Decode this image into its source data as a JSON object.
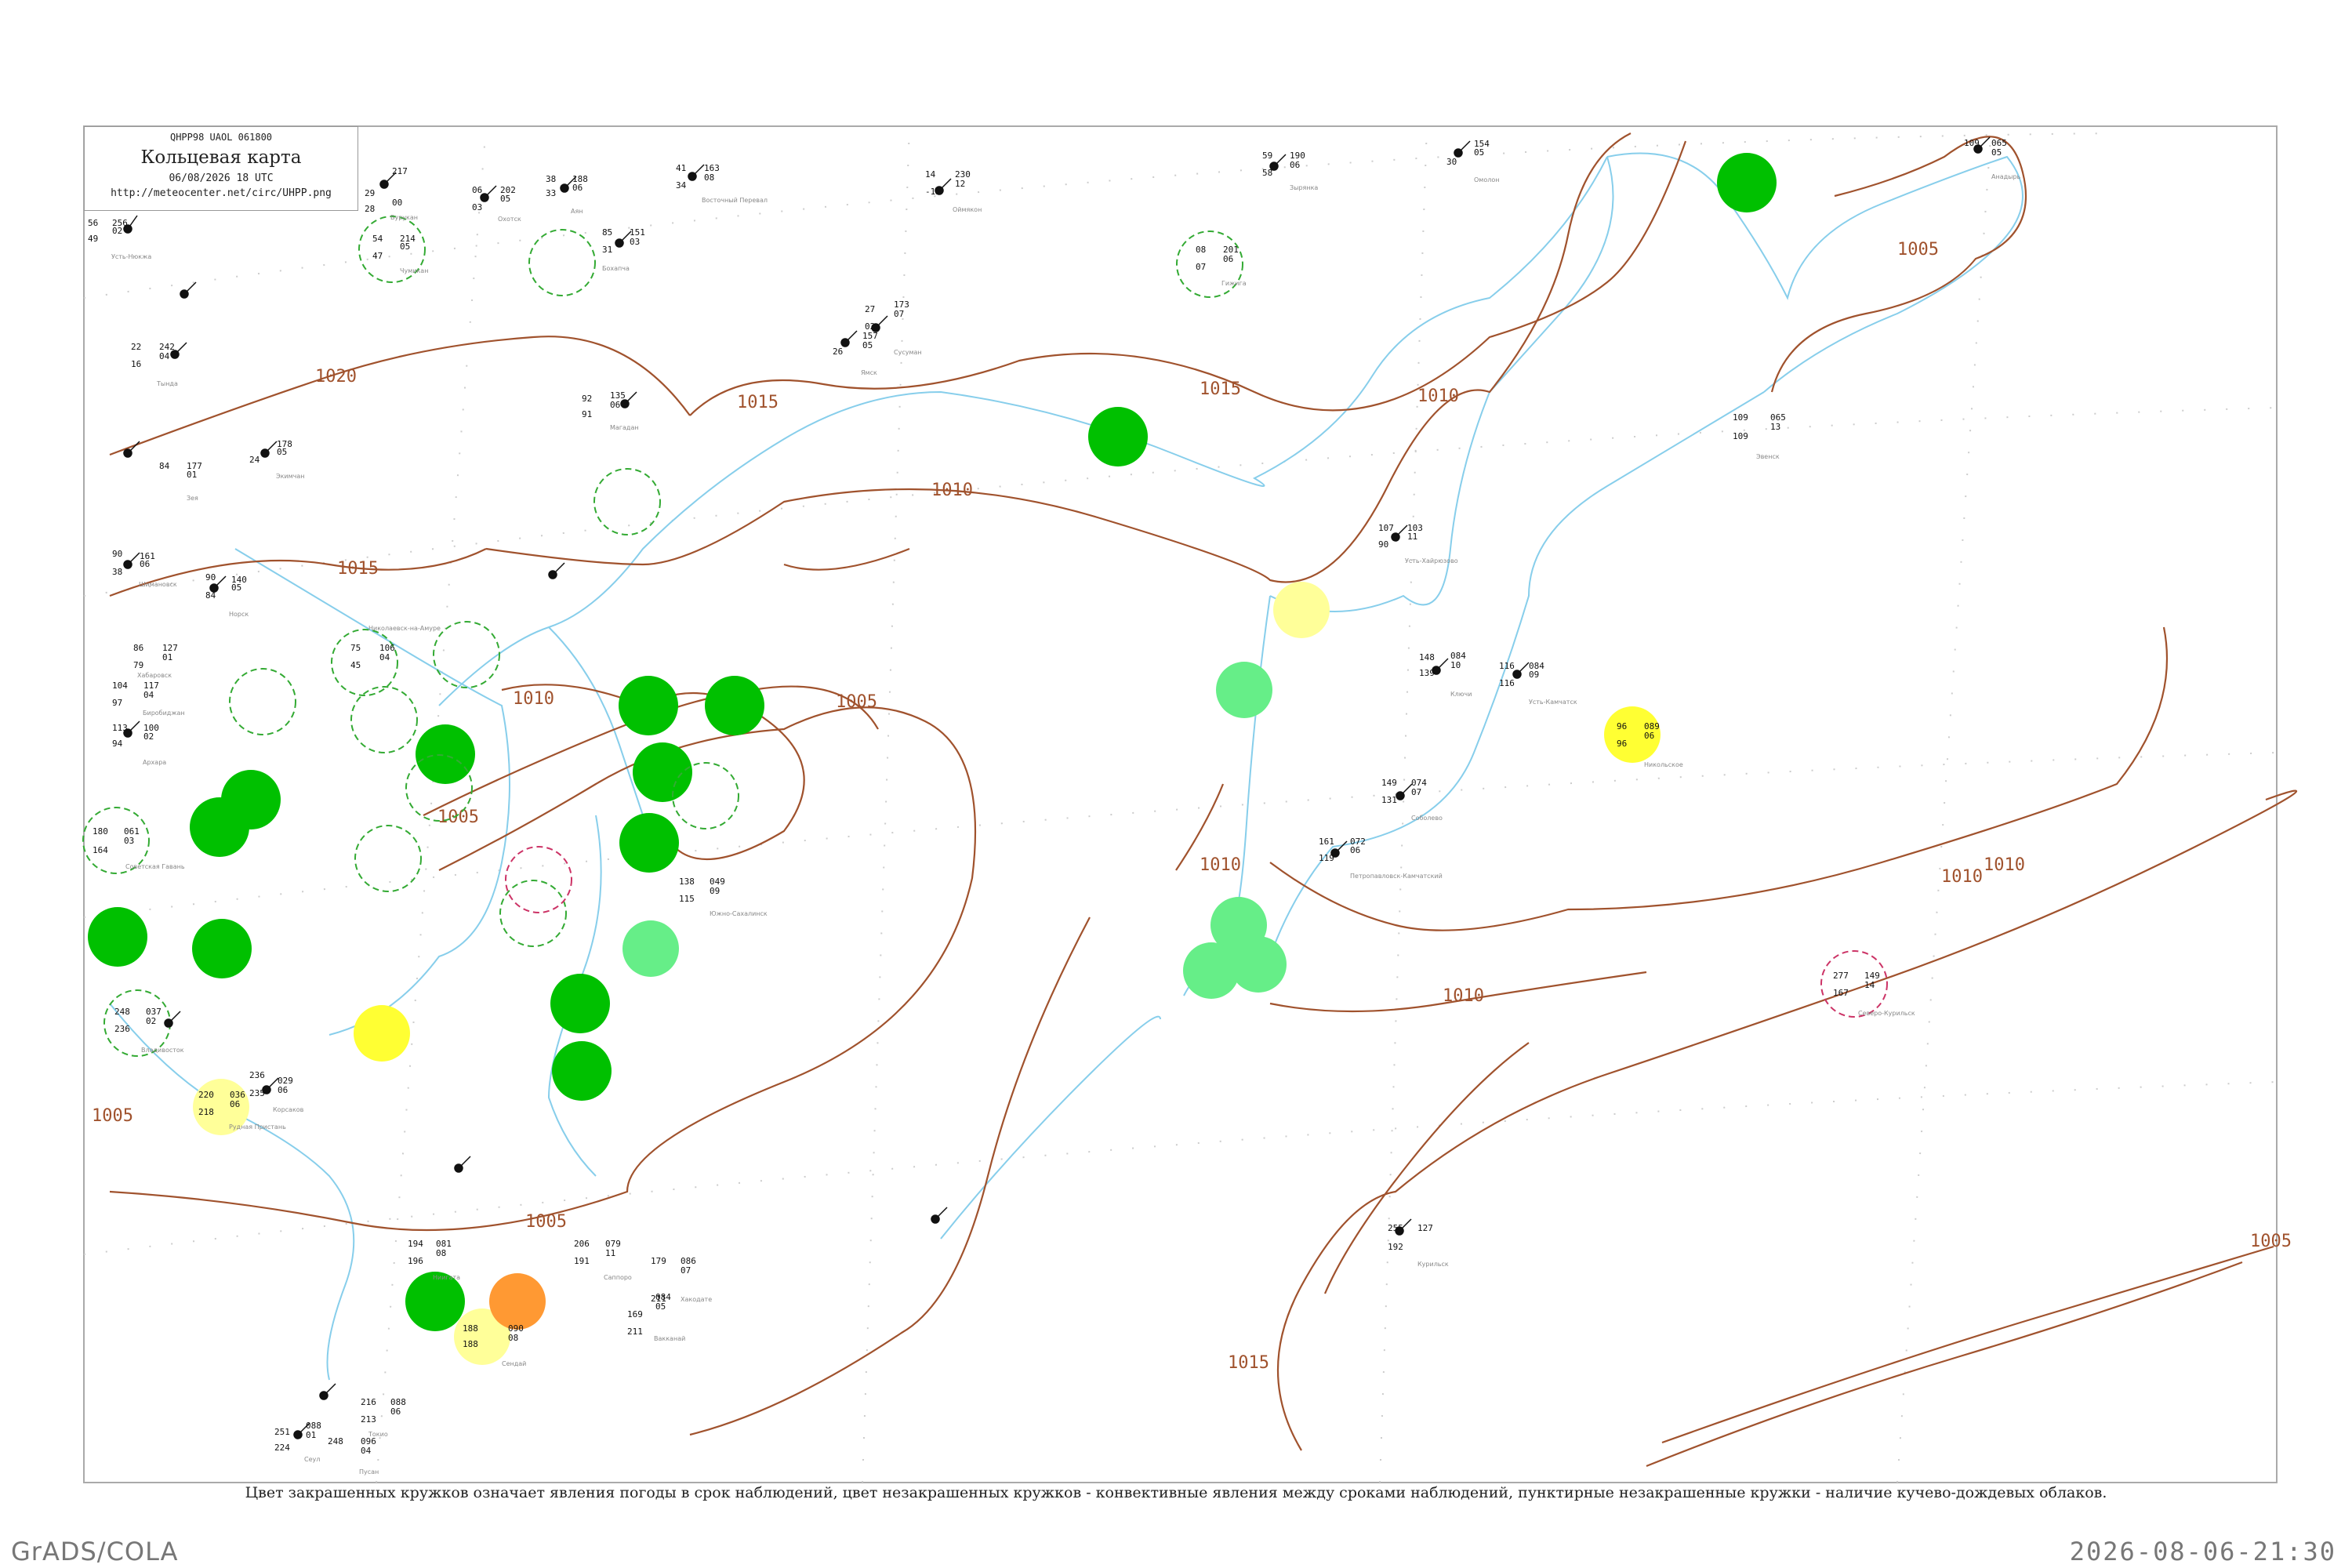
{
  "legend": {
    "code": "QHPP98  UAOL  061800",
    "title": "Кольцевая карта",
    "date": "06/08/2026 18 UTC",
    "url": "http://meteocenter.net/circ/UHPP.png"
  },
  "caption": "Цвет закрашенных кружков означает явления погоды в срок наблюдений, цвет незакрашенных кружков - конвективные явления между сроками наблюдений, пунктирные незакрашенные кружки - наличие кучево-дождевых облаков.",
  "footer": {
    "left": "GrADS/COLA",
    "right": "2026-08-06-21:30"
  },
  "colors": {
    "isobar": "#a0522d",
    "water": "#87ceeb",
    "thunder_green": "#00c000",
    "shower_light_green": "#66ee88",
    "rain_yellow": "#ffff33",
    "drizzle_pale_yellow": "#ffff99",
    "orange": "#ff9933",
    "cb_circle_green": "#33aa33",
    "cb_circle_red": "#cc3366"
  },
  "isobars": [
    "1020",
    "1015",
    "1015",
    "1015",
    "1010",
    "1010",
    "1010",
    "1010",
    "1010",
    "1005",
    "1005",
    "1005",
    "1005",
    "1005",
    "1015",
    "1010",
    "1005",
    "1010"
  ],
  "stations": [
    {
      "name": "Усть-Нюкжа",
      "p": "256",
      "t": "56",
      "td": "49",
      "tend": "02"
    },
    {
      "name": "Тында",
      "p": "242",
      "t": "22",
      "td": "16",
      "tend": "04"
    },
    {
      "name": "Зея",
      "p": "177",
      "t": "84",
      "td": "",
      "tend": "01"
    },
    {
      "name": "Шимановск",
      "p": "161",
      "t": "90",
      "td": "38",
      "tend": "06"
    },
    {
      "name": "Архара",
      "p": "100",
      "t": "113",
      "td": "94",
      "tend": "02"
    },
    {
      "name": "Экимчан",
      "p": "178",
      "t": "",
      "td": "24",
      "tend": "05"
    },
    {
      "name": "Норск",
      "p": "140",
      "t": "90",
      "td": "84",
      "tend": "05"
    },
    {
      "name": "Бурукан",
      "p": "217",
      "t": "29",
      "td": "28",
      "tend": "00"
    },
    {
      "name": "Охотск",
      "p": "202",
      "t": "06",
      "td": "03",
      "tend": "05"
    },
    {
      "name": "Аян",
      "p": "188",
      "t": "38",
      "td": "33",
      "tend": "06"
    },
    {
      "name": "Чумикан",
      "p": "214",
      "t": "54",
      "td": "47",
      "tend": "05"
    },
    {
      "name": "Бохапча",
      "p": "151",
      "t": "85",
      "td": "31",
      "tend": "03"
    },
    {
      "name": "Восточный Перевал",
      "p": "163",
      "t": "41",
      "td": "34",
      "tend": "08"
    },
    {
      "name": "Оймякон",
      "p": "230",
      "t": "14",
      "td": "-15",
      "tend": "12"
    },
    {
      "name": "Зырянка",
      "p": "190",
      "t": "59",
      "td": "58",
      "tend": "06"
    },
    {
      "name": "Омолон",
      "p": "154",
      "t": "",
      "td": "30",
      "tend": "05"
    },
    {
      "name": "Анадырь",
      "p": "065",
      "t": "109",
      "td": "",
      "tend": "05"
    },
    {
      "name": "Гижига",
      "p": "201",
      "t": "08",
      "td": "07",
      "tend": "06"
    },
    {
      "name": "Сусуман",
      "p": "173",
      "t": "27",
      "td": "02",
      "tend": "07"
    },
    {
      "name": "Ямск",
      "p": "157",
      "t": "",
      "td": "26",
      "tend": "05"
    },
    {
      "name": "Магадан",
      "p": "135",
      "t": "92",
      "td": "91",
      "tend": "06"
    },
    {
      "name": "Эвенск",
      "p": "065",
      "t": "109",
      "td": "109",
      "tend": "13"
    },
    {
      "name": "Ключи",
      "p": "084",
      "t": "148",
      "td": "139",
      "tend": "10"
    },
    {
      "name": "Усть-Камчатск",
      "p": "084",
      "t": "116",
      "td": "116",
      "tend": "09"
    },
    {
      "name": "Петропавловск-Камчатский",
      "p": "072",
      "t": "161",
      "td": "119",
      "tend": "06"
    },
    {
      "name": "Усть-Хайрюзово",
      "p": "103",
      "t": "107",
      "td": "90",
      "tend": "11"
    },
    {
      "name": "Соболево",
      "p": "074",
      "t": "149",
      "td": "131",
      "tend": "07"
    },
    {
      "name": "Хабаровск",
      "p": "127",
      "t": "86",
      "td": "79",
      "tend": "01"
    },
    {
      "name": "Биробиджан",
      "p": "117",
      "t": "104",
      "td": "97",
      "tend": "04"
    },
    {
      "name": "Николаевск-на-Амуре",
      "p": "106",
      "t": "75",
      "td": "45",
      "tend": "04"
    },
    {
      "name": "Советская Гавань",
      "p": "061",
      "t": "180",
      "td": "164",
      "tend": "03"
    },
    {
      "name": "Владивосток",
      "p": "037",
      "t": "248",
      "td": "236",
      "tend": "02"
    },
    {
      "name": "Рудная Пристань",
      "p": "036",
      "t": "220",
      "td": "218",
      "tend": "06"
    },
    {
      "name": "Южно-Сахалинск",
      "p": "049",
      "t": "138",
      "td": "115",
      "tend": "09"
    },
    {
      "name": "Корсаков",
      "p": "029",
      "t": "236",
      "td": "235",
      "tend": "06"
    },
    {
      "name": "Курильск",
      "p": "127",
      "t": "255",
      "td": "192",
      "tend": ""
    },
    {
      "name": "Северо-Курильск",
      "p": "149",
      "t": "277",
      "td": "167",
      "tend": "14"
    },
    {
      "name": "Никольское",
      "p": "089",
      "t": "96",
      "td": "96",
      "tend": "06"
    },
    {
      "name": "Саппоро",
      "p": "079",
      "t": "206",
      "td": "191",
      "tend": "11"
    },
    {
      "name": "Хакодате",
      "p": "086",
      "t": "179",
      "td": "211",
      "tend": "07"
    },
    {
      "name": "Вакканай",
      "p": "084",
      "t": "169",
      "td": "211",
      "tend": "05"
    },
    {
      "name": "Ниигата",
      "p": "081",
      "t": "194",
      "td": "196",
      "tend": "08"
    },
    {
      "name": "Сендай",
      "p": "090",
      "t": "188",
      "td": "188",
      "tend": "08"
    },
    {
      "name": "Токио",
      "p": "088",
      "t": "216",
      "td": "213",
      "tend": "06"
    },
    {
      "name": "Сеул",
      "p": "088",
      "t": "251",
      "td": "224",
      "tend": "01"
    },
    {
      "name": "Пусан",
      "p": "096",
      "t": "248",
      "td": "",
      "tend": "04"
    }
  ]
}
